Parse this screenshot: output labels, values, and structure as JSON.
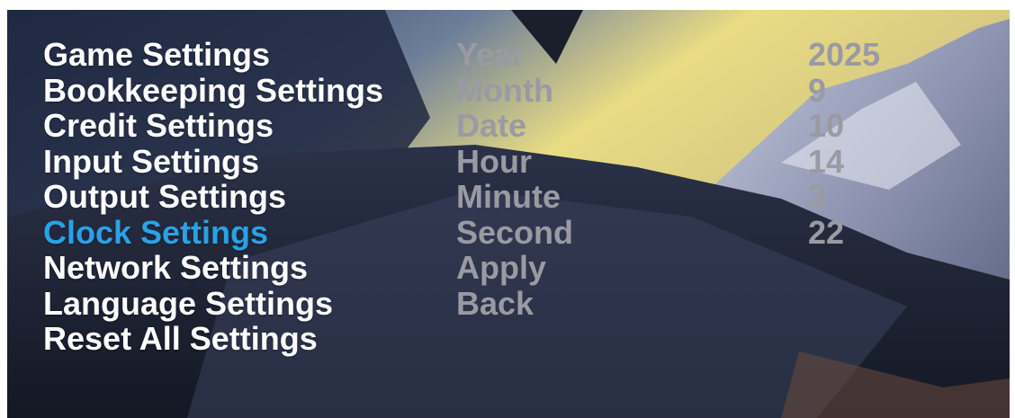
{
  "menu": {
    "items": [
      {
        "label": "Game Settings"
      },
      {
        "label": "Bookkeeping Settings"
      },
      {
        "label": "Credit Settings"
      },
      {
        "label": "Input Settings"
      },
      {
        "label": "Output Settings"
      },
      {
        "label": "Clock Settings"
      },
      {
        "label": "Network Settings"
      },
      {
        "label": "Language Settings"
      },
      {
        "label": "Reset All Settings"
      }
    ],
    "selected_label": "Clock Settings",
    "selected_color": "#29a2e6"
  },
  "clock": {
    "fields": [
      {
        "label": "Year",
        "value": "2025"
      },
      {
        "label": "Month",
        "value": "9"
      },
      {
        "label": "Date",
        "value": "10"
      },
      {
        "label": "Hour",
        "value": "14"
      },
      {
        "label": "Minute",
        "value": "3"
      },
      {
        "label": "Second",
        "value": "22"
      }
    ],
    "actions": {
      "apply_label": "Apply",
      "back_label": "Back"
    }
  },
  "background": {
    "description_icon": "mountain-landscape-painting",
    "colors": {
      "sky_yellow": "#e6d87a",
      "mountain_dark": "#232a3e",
      "snow": "#d9dbe6"
    }
  }
}
